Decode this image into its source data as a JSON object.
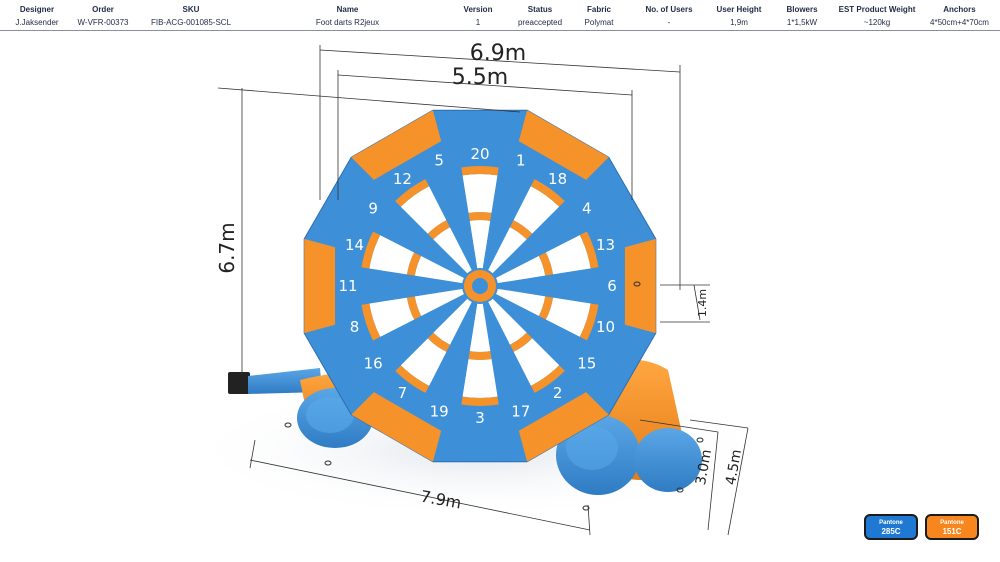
{
  "spec": {
    "headers": [
      "Designer",
      "Order",
      "SKU",
      "Name",
      "Version",
      "Status",
      "Fabric",
      "No. of Users",
      "User Height",
      "Blowers",
      "EST Product Weight",
      "Anchors"
    ],
    "values": [
      "J.Jaksender",
      "W-VFR-00373",
      "FIB-ACG-001085-SCL",
      "Foot darts R2jeux",
      "1",
      "preaccepted",
      "Polymat",
      "-",
      "1,9m",
      "1*1,5kW",
      "~120kg",
      "4*50cm+4*70cm"
    ]
  },
  "dimensions": {
    "total_width": "6.9m",
    "board_width": "5.5m",
    "height": "6.7m",
    "base_length": "7.9m",
    "tube_depth": "3.0m",
    "base_depth": "4.5m",
    "side_height": "1.4m"
  },
  "board": {
    "numbers": [
      "20",
      "1",
      "18",
      "4",
      "13",
      "6",
      "10",
      "15",
      "2",
      "17",
      "3",
      "19",
      "7",
      "16",
      "8",
      "11",
      "14",
      "9",
      "12",
      "5"
    ]
  },
  "colors": {
    "blue": "#3d8fd8",
    "orange": "#f5922a",
    "white": "#ffffff"
  },
  "swatches": [
    {
      "label": "Pantone",
      "value": "285C",
      "color": "#1f78d1"
    },
    {
      "label": "Pantone",
      "value": "151C",
      "color": "#f7861e"
    }
  ]
}
